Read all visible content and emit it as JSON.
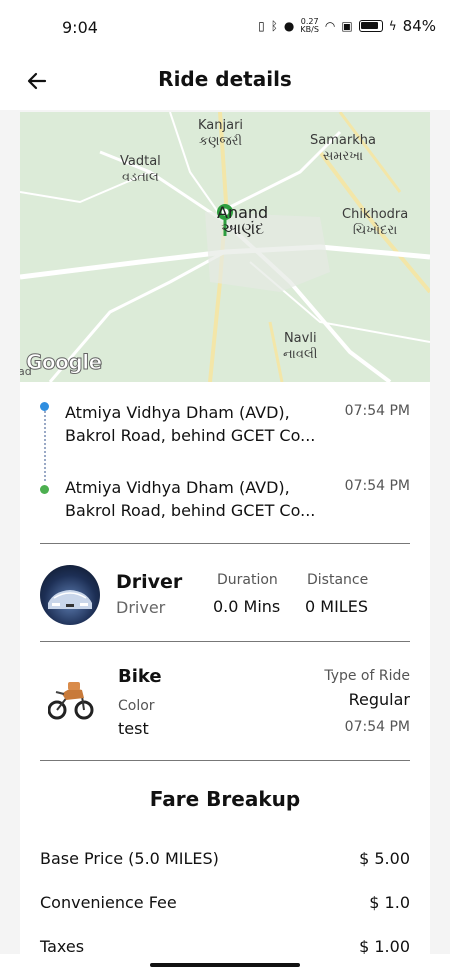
{
  "status_bar": {
    "time": "9:04",
    "net_speed": "0.27",
    "net_unit": "KB/S",
    "battery": "84%"
  },
  "app_bar": {
    "title": "Ride details",
    "back_icon": "arrow-left-icon"
  },
  "map": {
    "labels": {
      "kanjari_en": "Kanjari",
      "kanjari_gu": "કણજરી",
      "samarkha_en": "Samarkha",
      "samarkha_gu": "સમરખા",
      "vadtal_en": "Vadtal",
      "vadtal_gu": "વડતાલ",
      "anand_en": "Anand",
      "anand_gu": "આણંદ",
      "chikhodra_en": "Chikhodra",
      "chikhodra_gu": "ચિખોદરા",
      "navli_en": "Navli",
      "navli_gu": "નાવલી"
    },
    "attribution": "Google",
    "edge_char": "ad",
    "colors": {
      "land": "#dcebd8",
      "road": "#ffffff",
      "highway": "#f3e6a8",
      "marker": "#2e9e3f"
    }
  },
  "route": {
    "pickup": {
      "address": "Atmiya Vidhya Dham (AVD), Bakrol Road, behind GCET Co...",
      "time": "07:54 PM",
      "dot_color": "#2f8ee0"
    },
    "drop": {
      "address": "Atmiya Vidhya Dham (AVD), Bakrol Road, behind GCET Co...",
      "time": "07:54 PM",
      "dot_color": "#4caf50"
    }
  },
  "driver": {
    "name": "Driver",
    "role": "Driver",
    "duration_label": "Duration",
    "duration_value": "0.0 Mins",
    "distance_label": "Distance",
    "distance_value": "0 MILES"
  },
  "vehicle": {
    "name": "Bike",
    "color_label": "Color",
    "color_value": "test",
    "type_label": "Type of Ride",
    "type_value": "Regular",
    "time": "07:54 PM"
  },
  "fare": {
    "title": "Fare Breakup",
    "rows": [
      {
        "label": "Base Price (5.0 MILES)",
        "value": "$ 5.00"
      },
      {
        "label": "Convenience Fee",
        "value": "$ 1.0"
      },
      {
        "label": "Taxes",
        "value": "$ 1.00"
      }
    ]
  }
}
